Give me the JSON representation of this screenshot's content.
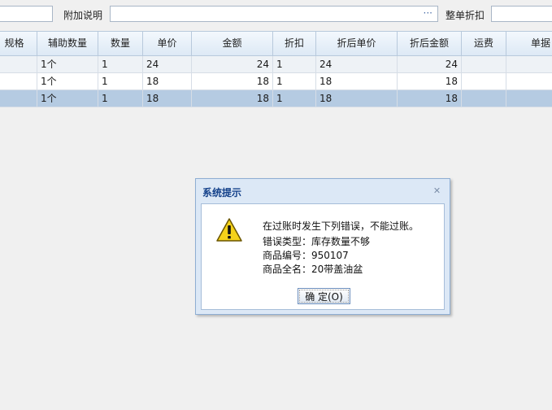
{
  "topbar": {
    "note_label": "附加说明",
    "note_dots": "···",
    "discount_label": "整单折扣"
  },
  "grid": {
    "headers": [
      "规格",
      "辅助数量",
      "数量",
      "单价",
      "金额",
      "折扣",
      "折后单价",
      "折后金额",
      "运费",
      "单据"
    ],
    "rows": [
      {
        "aux_qty": "1个",
        "qty": "1",
        "unit_price": "24",
        "amount": "24",
        "discount": "1",
        "disc_price": "24",
        "disc_amount": "24"
      },
      {
        "aux_qty": "1个",
        "qty": "1",
        "unit_price": "18",
        "amount": "18",
        "discount": "1",
        "disc_price": "18",
        "disc_amount": "18"
      },
      {
        "aux_qty": "1个",
        "qty": "1",
        "unit_price": "18",
        "amount": "18",
        "discount": "1",
        "disc_price": "18",
        "disc_amount": "18"
      }
    ]
  },
  "dialog": {
    "title": "系统提示",
    "close_glyph": "✕",
    "lines": [
      "在过账时发生下列错误，不能过账。",
      "错误类型：库存数量不够",
      "商品编号：950107",
      "商品全名：20带盖油盆"
    ],
    "ok_label": "确 定(O)",
    "icon": "warning-icon"
  }
}
